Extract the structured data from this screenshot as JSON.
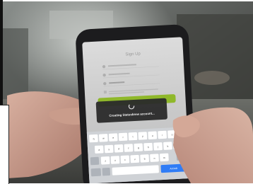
{
  "scene": {
    "subject": "phone-signup-screen",
    "screen": {
      "title": "Sign Up",
      "toast": "Creating Statusbrew account...",
      "keyboard": {
        "rows": [
          [
            "q",
            "w",
            "e",
            "r",
            "t",
            "y",
            "u",
            "i",
            "o",
            "p"
          ],
          [
            "a",
            "s",
            "d",
            "f",
            "g",
            "h",
            "j",
            "k",
            "l"
          ],
          [
            "z",
            "x",
            "c",
            "v",
            "b",
            "n",
            "m"
          ]
        ],
        "action_key": "Accedi"
      }
    },
    "colors": {
      "accent_green": "#8fb82a",
      "toast_bg": "#2a2a2a",
      "phone_body": "#1c1c1e"
    }
  }
}
